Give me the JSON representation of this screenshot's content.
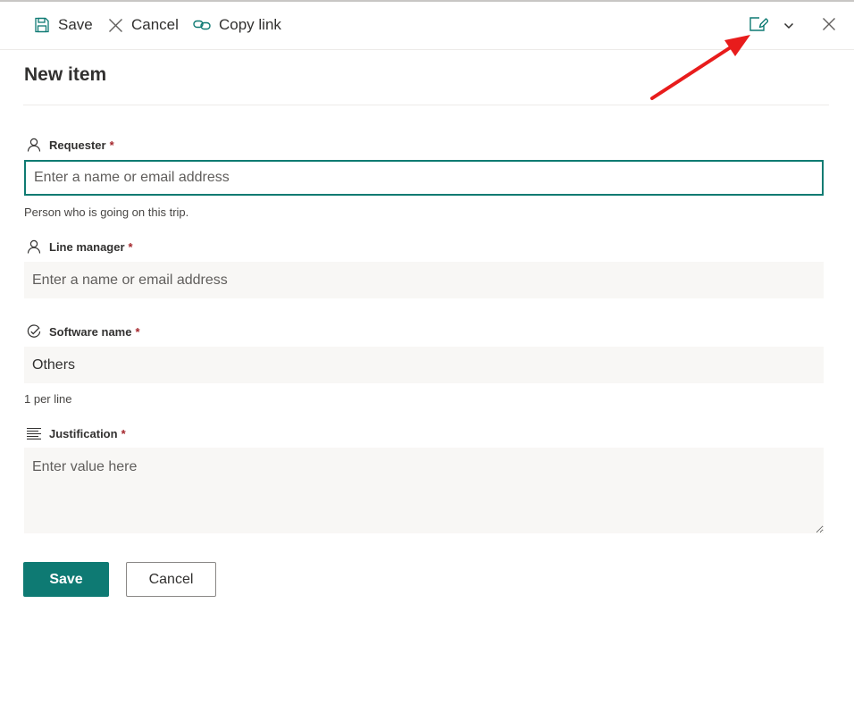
{
  "toolbar": {
    "save_label": "Save",
    "cancel_label": "Cancel",
    "copy_link_label": "Copy link"
  },
  "form": {
    "title": "New item",
    "fields": [
      {
        "label": "Requester",
        "required_mark": "*",
        "icon": "person-icon",
        "placeholder": "Enter a name or email address",
        "value": "",
        "help": "Person who is going on this trip."
      },
      {
        "label": "Line manager",
        "required_mark": "*",
        "icon": "person-icon",
        "placeholder": "Enter a name or email address",
        "value": ""
      },
      {
        "label": "Software name",
        "required_mark": "*",
        "icon": "check-circle-icon",
        "placeholder": "",
        "value": "Others",
        "help": "1 per line"
      },
      {
        "label": "Justification",
        "required_mark": "*",
        "icon": "text-lines-icon",
        "placeholder": "Enter value here",
        "value": ""
      }
    ]
  },
  "footer": {
    "save_label": "Save",
    "cancel_label": "Cancel"
  },
  "colors": {
    "accent": "#0e7a73",
    "required": "#a4262c",
    "annotation_arrow": "#e81c1c"
  }
}
